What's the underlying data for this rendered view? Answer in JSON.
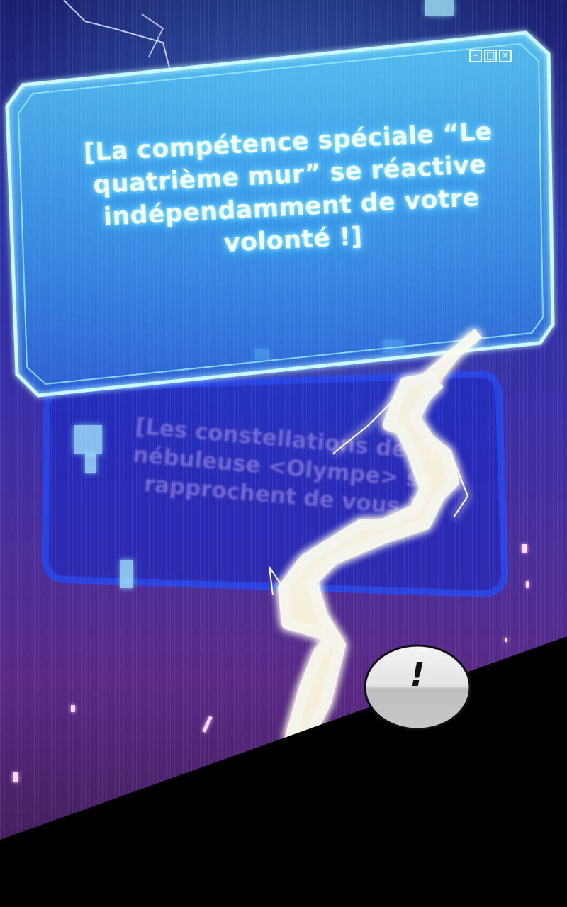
{
  "panel": {
    "main_window": {
      "controls": [
        "–",
        "□",
        "×"
      ],
      "message": "[La compétence spéciale “Le quatrième mur” se réactive indépendamment de votre volonté !]"
    },
    "secondary_window": {
      "message": "[Les constellations de la nébuleuse <Olympe> se rapprochent de vous.]"
    },
    "speech_bubble": {
      "text": "!"
    }
  },
  "colors": {
    "background_top": "#1a1f6e",
    "background_bottom": "#5a2a86",
    "window_glow": "#5fd8ff",
    "lightning": "#ffffe8",
    "floor": "#000000",
    "bubble_fill": "#e6e6e6"
  },
  "icons": [
    "minimize-icon",
    "maximize-icon",
    "close-icon",
    "lightning-bolt",
    "exclamation-bubble"
  ]
}
